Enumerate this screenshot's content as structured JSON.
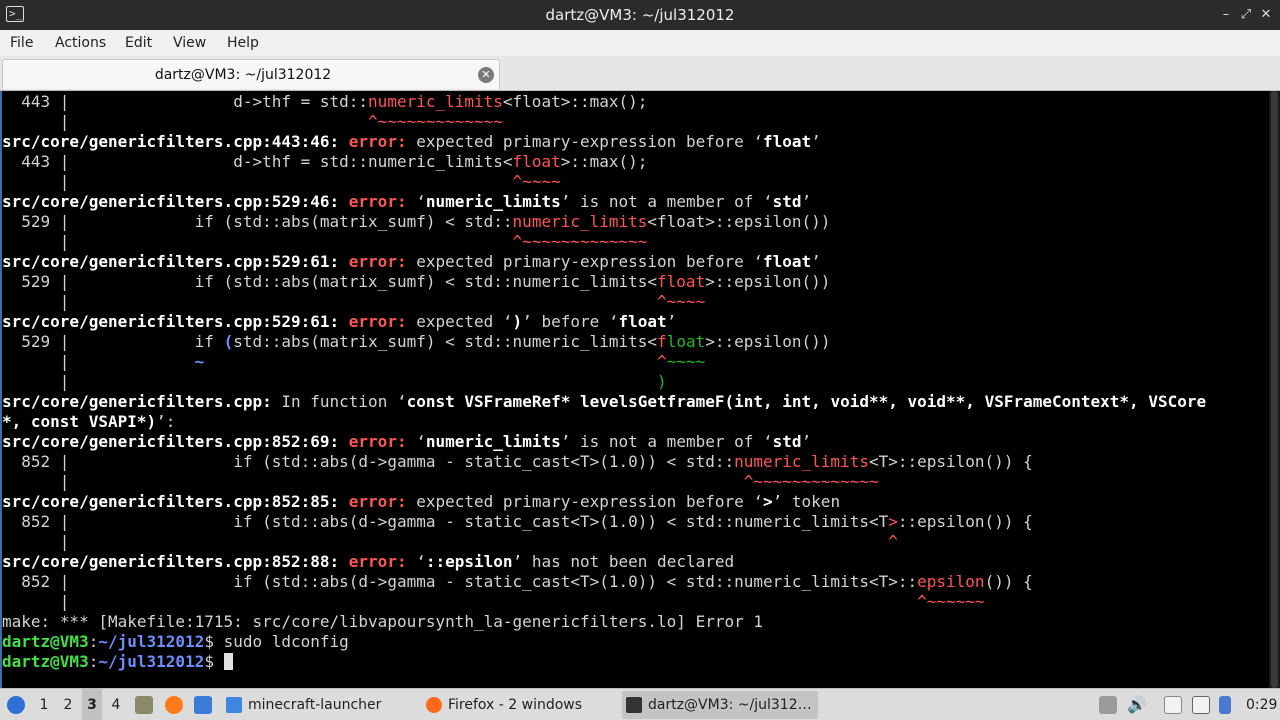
{
  "window": {
    "title": "dartz@VM3: ~/jul312012",
    "app_icon_label": ">_",
    "controls": [
      "–",
      "⤢",
      "✕"
    ]
  },
  "menubar": {
    "items": [
      "File",
      "Actions",
      "Edit",
      "View",
      "Help"
    ]
  },
  "tab": {
    "label": "dartz@VM3: ~/jul312012",
    "close": "✕"
  },
  "terminal": {
    "lines": [
      [
        [
          "n",
          "  443 |                 d->thf = std::"
        ],
        [
          "hl",
          "numeric_limits"
        ],
        [
          "n",
          "<float>::max();"
        ]
      ],
      [
        [
          "n",
          "      |                               "
        ],
        [
          "caret",
          "^~~~~~~~~~~~~~"
        ]
      ],
      [
        [
          "b",
          "src/core/genericfilters.cpp:443:46: "
        ],
        [
          "e",
          "error: "
        ],
        [
          "n",
          "expected primary-expression before ‘"
        ],
        [
          "b",
          "float"
        ],
        [
          "n",
          "’"
        ]
      ],
      [
        [
          "n",
          "  443 |                 d->thf = std::numeric_limits<"
        ],
        [
          "hl",
          "float"
        ],
        [
          "n",
          ">::max();"
        ]
      ],
      [
        [
          "n",
          "      |                                              "
        ],
        [
          "caret",
          "^~~~~"
        ]
      ],
      [
        [
          "b",
          "src/core/genericfilters.cpp:529:46: "
        ],
        [
          "e",
          "error: "
        ],
        [
          "n",
          "‘"
        ],
        [
          "b",
          "numeric_limits"
        ],
        [
          "n",
          "’ is not a member of ‘"
        ],
        [
          "b",
          "std"
        ],
        [
          "n",
          "’"
        ]
      ],
      [
        [
          "n",
          "  529 |             if (std::abs(matrix_sumf) < std::"
        ],
        [
          "hl",
          "numeric_limits"
        ],
        [
          "n",
          "<float>::epsilon())"
        ]
      ],
      [
        [
          "n",
          "      |                                              "
        ],
        [
          "caret",
          "^~~~~~~~~~~~~~"
        ]
      ],
      [
        [
          "b",
          "src/core/genericfilters.cpp:529:61: "
        ],
        [
          "e",
          "error: "
        ],
        [
          "n",
          "expected primary-expression before ‘"
        ],
        [
          "b",
          "float"
        ],
        [
          "n",
          "’"
        ]
      ],
      [
        [
          "n",
          "  529 |             if (std::abs(matrix_sumf) < std::numeric_limits<"
        ],
        [
          "hl",
          "float"
        ],
        [
          "n",
          ">::epsilon())"
        ]
      ],
      [
        [
          "n",
          "      |                                                             "
        ],
        [
          "caret",
          "^~~~~"
        ]
      ],
      [
        [
          "b",
          "src/core/genericfilters.cpp:529:61: "
        ],
        [
          "e",
          "error: "
        ],
        [
          "n",
          "expected ‘"
        ],
        [
          "b",
          ")"
        ],
        [
          "n",
          "’ before ‘"
        ],
        [
          "b",
          "float"
        ],
        [
          "n",
          "’"
        ]
      ],
      [
        [
          "n",
          "  529 |             if "
        ],
        [
          "p",
          "("
        ],
        [
          "n",
          "std::abs(matrix_sumf) < std::numeric_limits<"
        ],
        [
          "hl",
          "f"
        ],
        [
          "g",
          "loat"
        ],
        [
          "n",
          ">::epsilon())"
        ]
      ],
      [
        [
          "n",
          "      |             "
        ],
        [
          "p",
          "~"
        ],
        [
          "n",
          "                                               "
        ],
        [
          "caret",
          "^"
        ],
        [
          "g",
          "~~~~"
        ]
      ],
      [
        [
          "n",
          "      |                                                             "
        ],
        [
          "g",
          ")"
        ]
      ],
      [
        [
          "b",
          "src/core/genericfilters.cpp: "
        ],
        [
          "n",
          "In function ‘"
        ],
        [
          "b",
          "const VSFrameRef* levelsGetframeF(int, int, void**, void**, VSFrameContext*, VSCore"
        ]
      ],
      [
        [
          "b",
          "*, const VSAPI*)"
        ],
        [
          "n",
          "’:"
        ]
      ],
      [
        [
          "b",
          "src/core/genericfilters.cpp:852:69: "
        ],
        [
          "e",
          "error: "
        ],
        [
          "n",
          "‘"
        ],
        [
          "b",
          "numeric_limits"
        ],
        [
          "n",
          "’ is not a member of ‘"
        ],
        [
          "b",
          "std"
        ],
        [
          "n",
          "’"
        ]
      ],
      [
        [
          "n",
          "  852 |                 if (std::abs(d->gamma - static_cast<T>(1.0)) < std::"
        ],
        [
          "hl",
          "numeric_limits"
        ],
        [
          "n",
          "<T>::epsilon()) {"
        ]
      ],
      [
        [
          "n",
          "      |                                                                      "
        ],
        [
          "caret",
          "^~~~~~~~~~~~~~"
        ]
      ],
      [
        [
          "b",
          "src/core/genericfilters.cpp:852:85: "
        ],
        [
          "e",
          "error: "
        ],
        [
          "n",
          "expected primary-expression before ‘"
        ],
        [
          "b",
          ">"
        ],
        [
          "n",
          "’ token"
        ]
      ],
      [
        [
          "n",
          "  852 |                 if (std::abs(d->gamma - static_cast<T>(1.0)) < std::numeric_limits<T"
        ],
        [
          "hl",
          ">"
        ],
        [
          "n",
          "::epsilon()) {"
        ]
      ],
      [
        [
          "n",
          "      |                                                                                     "
        ],
        [
          "caret",
          "^"
        ]
      ],
      [
        [
          "b",
          "src/core/genericfilters.cpp:852:88: "
        ],
        [
          "e",
          "error: "
        ],
        [
          "n",
          "‘"
        ],
        [
          "b",
          "::epsilon"
        ],
        [
          "n",
          "’ has not been declared"
        ]
      ],
      [
        [
          "n",
          "  852 |                 if (std::abs(d->gamma - static_cast<T>(1.0)) < std::numeric_limits<T>::"
        ],
        [
          "hl",
          "epsilon"
        ],
        [
          "n",
          "()) {"
        ]
      ],
      [
        [
          "n",
          "      |                                                                                        "
        ],
        [
          "caret",
          "^~~~~~~"
        ]
      ],
      [
        [
          "n",
          "make: *** [Makefile:1715: src/core/libvapoursynth_la-genericfilters.lo] Error 1"
        ]
      ],
      [
        [
          "u",
          "dartz@VM3"
        ],
        [
          "n",
          ":"
        ],
        [
          "w",
          "~/jul312012"
        ],
        [
          "n",
          "$ sudo ldconfig"
        ]
      ],
      [
        [
          "u",
          "dartz@VM3"
        ],
        [
          "n",
          ":"
        ],
        [
          "w",
          "~/jul312012"
        ],
        [
          "n",
          "$ "
        ],
        [
          "c",
          ""
        ]
      ]
    ]
  },
  "taskbar": {
    "workspaces": [
      "1",
      "2",
      "3",
      "4"
    ],
    "active_workspace": "3",
    "tasks": [
      {
        "label": "minecraft-launcher",
        "icon": "folder-icon"
      },
      {
        "label": "Firefox - 2 windows",
        "icon": "firefox-icon"
      },
      {
        "label": "dartz@VM3: ~/jul312…",
        "icon": "terminal-icon"
      }
    ],
    "clock": "0:29"
  },
  "colors": {
    "error_red": "#ff5555",
    "prompt_green": "#44e044",
    "prompt_blue": "#6e8dff",
    "terminal_bg": "#000000"
  }
}
